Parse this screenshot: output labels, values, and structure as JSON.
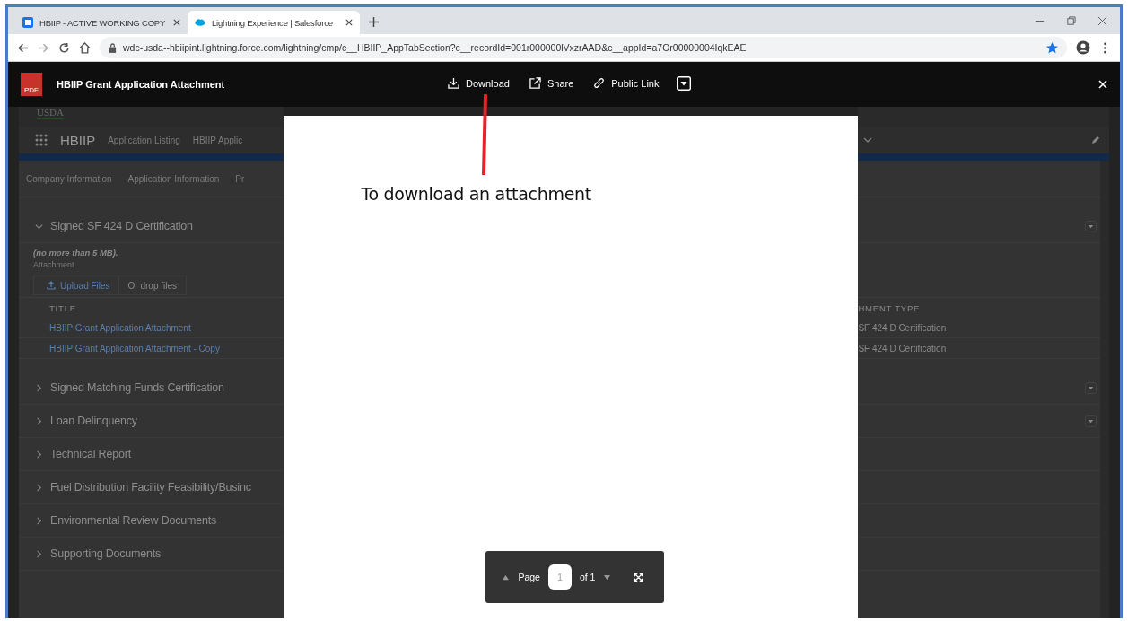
{
  "browser": {
    "tabs": [
      {
        "title": "HBIIP - ACTIVE WORKING COPY",
        "kind": "doc",
        "selected": false
      },
      {
        "title": "Lightning Experience | Salesforce",
        "kind": "cloud",
        "selected": true
      }
    ],
    "url": "wdc-usda--hbiipint.lightning.force.com/lightning/cmp/c__HBIIP_AppTabSection?c__recordId=001r000000lVxzrAAD&c__appId=a7Or00000004IqkEAE"
  },
  "viewer": {
    "file_type": "PDF",
    "title": "HBIIP Grant Application Attachment",
    "actions": [
      {
        "label": "Download",
        "kind": "download"
      },
      {
        "label": "Share",
        "kind": "share"
      },
      {
        "label": "Public Link",
        "kind": "link"
      }
    ]
  },
  "annotation": {
    "text": "To download an attachment"
  },
  "pager": {
    "label": "Page",
    "value": "1",
    "total": "of 1"
  },
  "background": {
    "logo": "USDA",
    "app_name": "HBIIP",
    "nav": [
      "Application Listing",
      "HBIIP Applic"
    ],
    "record_tabs": [
      "Company Information",
      "Application Information",
      "Pr"
    ],
    "sections": [
      {
        "title": "Signed SF 424 D Certification",
        "expanded": true,
        "has_menu": true,
        "note": "(no more than 5 MB).",
        "field_label": "Attachment",
        "upload": "Upload Files",
        "drop": "Or drop files",
        "columns": [
          "TITLE",
          "HMENT TYPE"
        ],
        "rows": [
          {
            "title": "HBIIP Grant Application Attachment",
            "type": "SF 424 D Certification"
          },
          {
            "title": "HBIIP Grant Application Attachment - Copy",
            "type": "SF 424 D Certification"
          }
        ]
      },
      {
        "title": "Signed Matching Funds Certification",
        "expanded": false,
        "has_menu": true
      },
      {
        "title": "Loan Delinquency",
        "expanded": false,
        "has_menu": true
      },
      {
        "title": "Technical Report",
        "expanded": false,
        "has_menu": false
      },
      {
        "title": "Fuel Distribution Facility Feasibility/Businc",
        "expanded": false,
        "has_menu": false
      },
      {
        "title": "Environmental Review Documents",
        "expanded": false,
        "has_menu": false
      },
      {
        "title": "Supporting Documents",
        "expanded": false,
        "has_menu": false
      }
    ]
  }
}
